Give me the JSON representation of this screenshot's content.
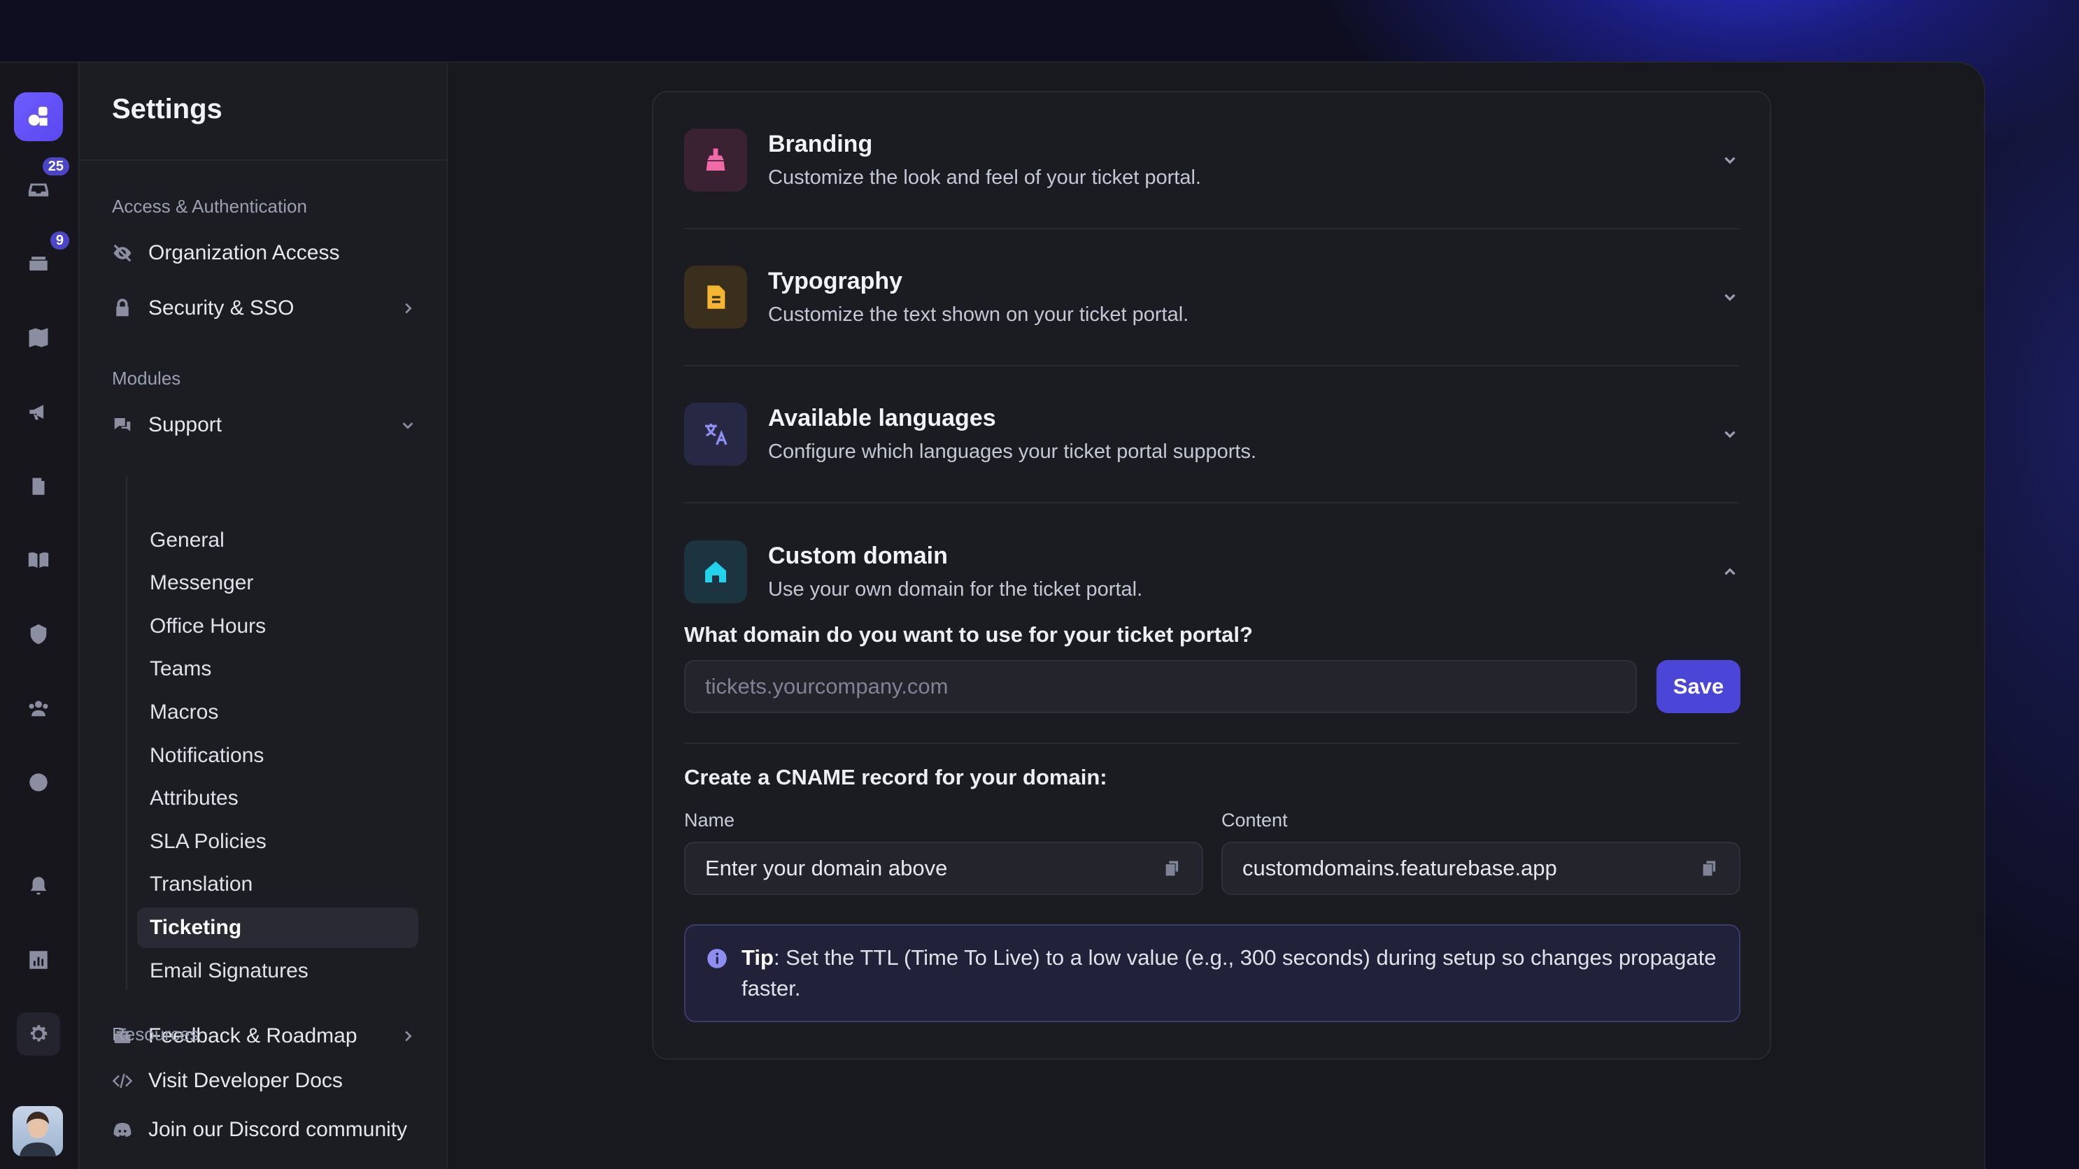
{
  "rail": {
    "badges": {
      "inbox": "25",
      "tickets": "9"
    }
  },
  "sidebar": {
    "title": "Settings",
    "sections": {
      "access": "Access & Authentication",
      "modules": "Modules",
      "resources": "Resources"
    },
    "access_items": [
      "Organization Access",
      "Security & SSO"
    ],
    "support_label": "Support",
    "support_items": [
      "General",
      "Messenger",
      "Office Hours",
      "Teams",
      "Macros",
      "Notifications",
      "Attributes",
      "SLA Policies",
      "Translation",
      "Ticketing",
      "Email Signatures"
    ],
    "active_item": "Ticketing",
    "feedback_label": "Feedback & Roadmap",
    "resource_items": [
      "Visit Developer Docs",
      "Join our Discord community"
    ]
  },
  "main": {
    "sections": [
      {
        "title": "Branding",
        "subtitle": "Customize the look and feel of your ticket portal.",
        "icon": "paint-brush-icon",
        "color": "#f06aa8"
      },
      {
        "title": "Typography",
        "subtitle": "Customize the text shown on your ticket portal.",
        "icon": "document-icon",
        "color": "#f5b731"
      },
      {
        "title": "Available languages",
        "subtitle": "Configure which languages your ticket portal supports.",
        "icon": "translate-icon",
        "color": "#8d8ff0"
      },
      {
        "title": "Custom domain",
        "subtitle": "Use your own domain for the ticket portal.",
        "icon": "home-icon",
        "color": "#22d3ee"
      }
    ],
    "custom_domain": {
      "question": "What domain do you want to use for your ticket portal?",
      "placeholder": "tickets.yourcompany.com",
      "save_label": "Save",
      "cname_heading": "Create a CNAME record for your domain:",
      "name_label": "Name",
      "name_value": "Enter your domain above",
      "content_label": "Content",
      "content_value": "customdomains.featurebase.app",
      "tip_label": "Tip",
      "tip_text": ": Set the TTL (Time To Live) to a low value (e.g., 300 seconds) during setup so changes propagate faster."
    }
  },
  "colors": {
    "accent": "#4b45d8",
    "background": "#18181f"
  }
}
